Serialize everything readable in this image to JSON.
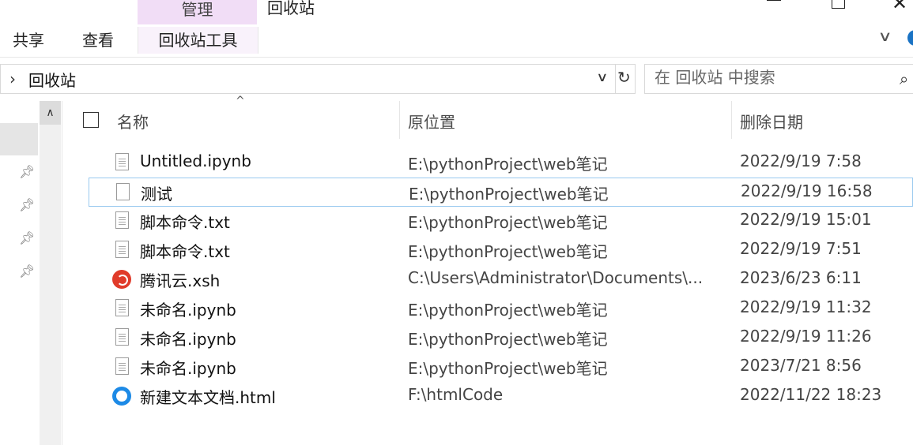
{
  "window": {
    "title": "回收站",
    "context_tab": "管理"
  },
  "ribbon": {
    "tabs": [
      "共享",
      "查看",
      "回收站工具"
    ]
  },
  "address": {
    "path": "回收站"
  },
  "search": {
    "placeholder": "在 回收站 中搜索"
  },
  "columns": {
    "name": "名称",
    "location": "原位置",
    "date": "删除日期"
  },
  "files": [
    {
      "name": "Untitled.ipynb",
      "location": "E:\\pythonProject\\web笔记",
      "date": "2022/9/19 7:58",
      "icon": "document-icon"
    },
    {
      "name": "测试",
      "location": "E:\\pythonProject\\web笔记",
      "date": "2022/9/19 16:58",
      "icon": "blank-file-icon"
    },
    {
      "name": "脚本命令.txt",
      "location": "E:\\pythonProject\\web笔记",
      "date": "2022/9/19 15:01",
      "icon": "text-file-icon"
    },
    {
      "name": "脚本命令.txt",
      "location": "E:\\pythonProject\\web笔记",
      "date": "2022/9/19 7:51",
      "icon": "text-file-icon"
    },
    {
      "name": "腾讯云.xsh",
      "location": "C:\\Users\\Administrator\\Documents\\...",
      "date": "2023/6/23 6:11",
      "icon": "xshell-icon"
    },
    {
      "name": "未命名.ipynb",
      "location": "E:\\pythonProject\\web笔记",
      "date": "2022/9/19 11:32",
      "icon": "document-icon"
    },
    {
      "name": "未命名.ipynb",
      "location": "E:\\pythonProject\\web笔记",
      "date": "2022/9/19 11:26",
      "icon": "document-icon"
    },
    {
      "name": "未命名.ipynb",
      "location": "E:\\pythonProject\\web笔记",
      "date": "2023/7/21 8:56",
      "icon": "document-icon"
    },
    {
      "name": "新建文本文档.html",
      "location": "F:\\htmlCode",
      "date": "2022/11/22 18:23",
      "icon": "browser-html-icon"
    }
  ],
  "selected_index": 1
}
